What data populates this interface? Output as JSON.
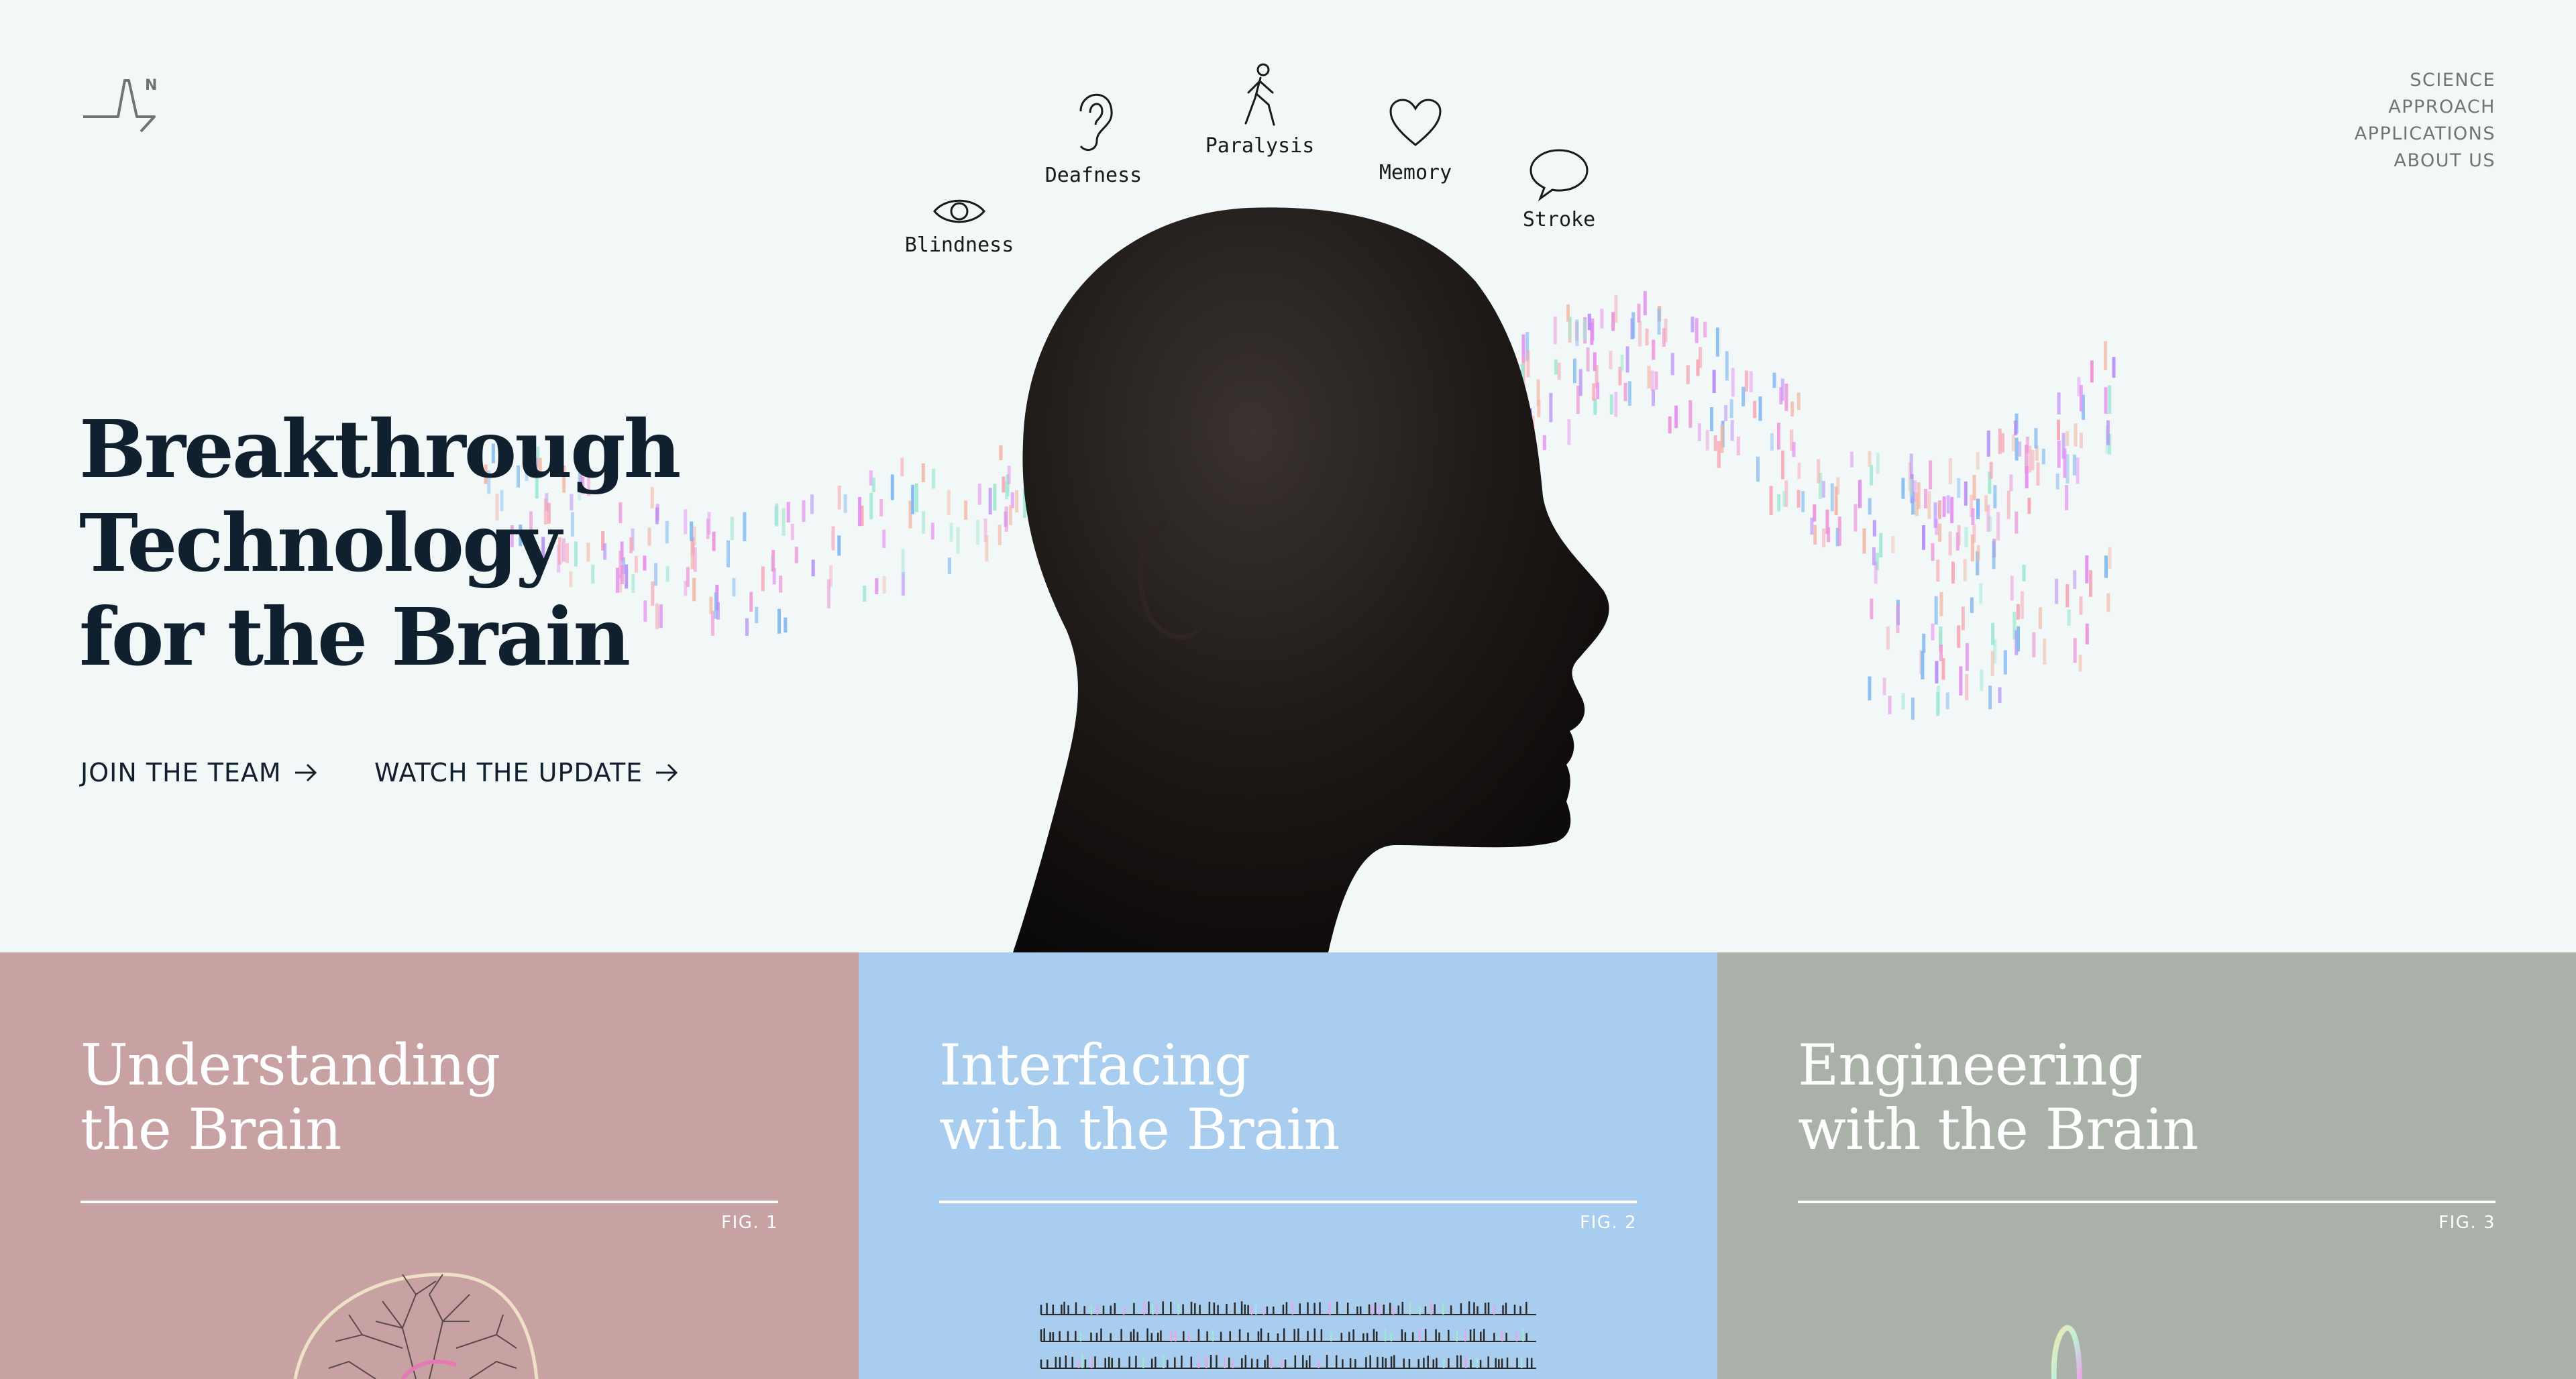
{
  "logo": {
    "letter": "N",
    "icon": "neuralink-wave-logo"
  },
  "nav": {
    "items": [
      {
        "label": "SCIENCE"
      },
      {
        "label": "APPROACH"
      },
      {
        "label": "APPLICATIONS"
      },
      {
        "label": "ABOUT US"
      }
    ]
  },
  "hero": {
    "headline": [
      "Breakthrough",
      "Technology",
      "for the Brain"
    ],
    "cta_primary": "JOIN THE TEAM",
    "cta_secondary": "WATCH THE UPDATE",
    "conditions": [
      {
        "label": "Blindness",
        "icon": "eye-icon"
      },
      {
        "label": "Deafness",
        "icon": "ear-icon"
      },
      {
        "label": "Paralysis",
        "icon": "walking-person-icon"
      },
      {
        "label": "Memory",
        "icon": "heart-icon"
      },
      {
        "label": "Stroke",
        "icon": "speech-bubble-icon"
      }
    ]
  },
  "panels": [
    {
      "title": [
        "Understanding",
        "the Brain"
      ],
      "fig": "FIG. 1",
      "color": "#c8a2a3"
    },
    {
      "title": [
        "Interfacing",
        "with the Brain"
      ],
      "fig": "FIG. 2",
      "color": "#a8cdee"
    },
    {
      "title": [
        "Engineering",
        "with the Brain"
      ],
      "fig": "FIG. 3",
      "color": "#a9b1a9"
    }
  ],
  "colors": {
    "text_dark": "#11202e",
    "nav_gray": "#6f7474",
    "background": "#f2f7f7"
  }
}
